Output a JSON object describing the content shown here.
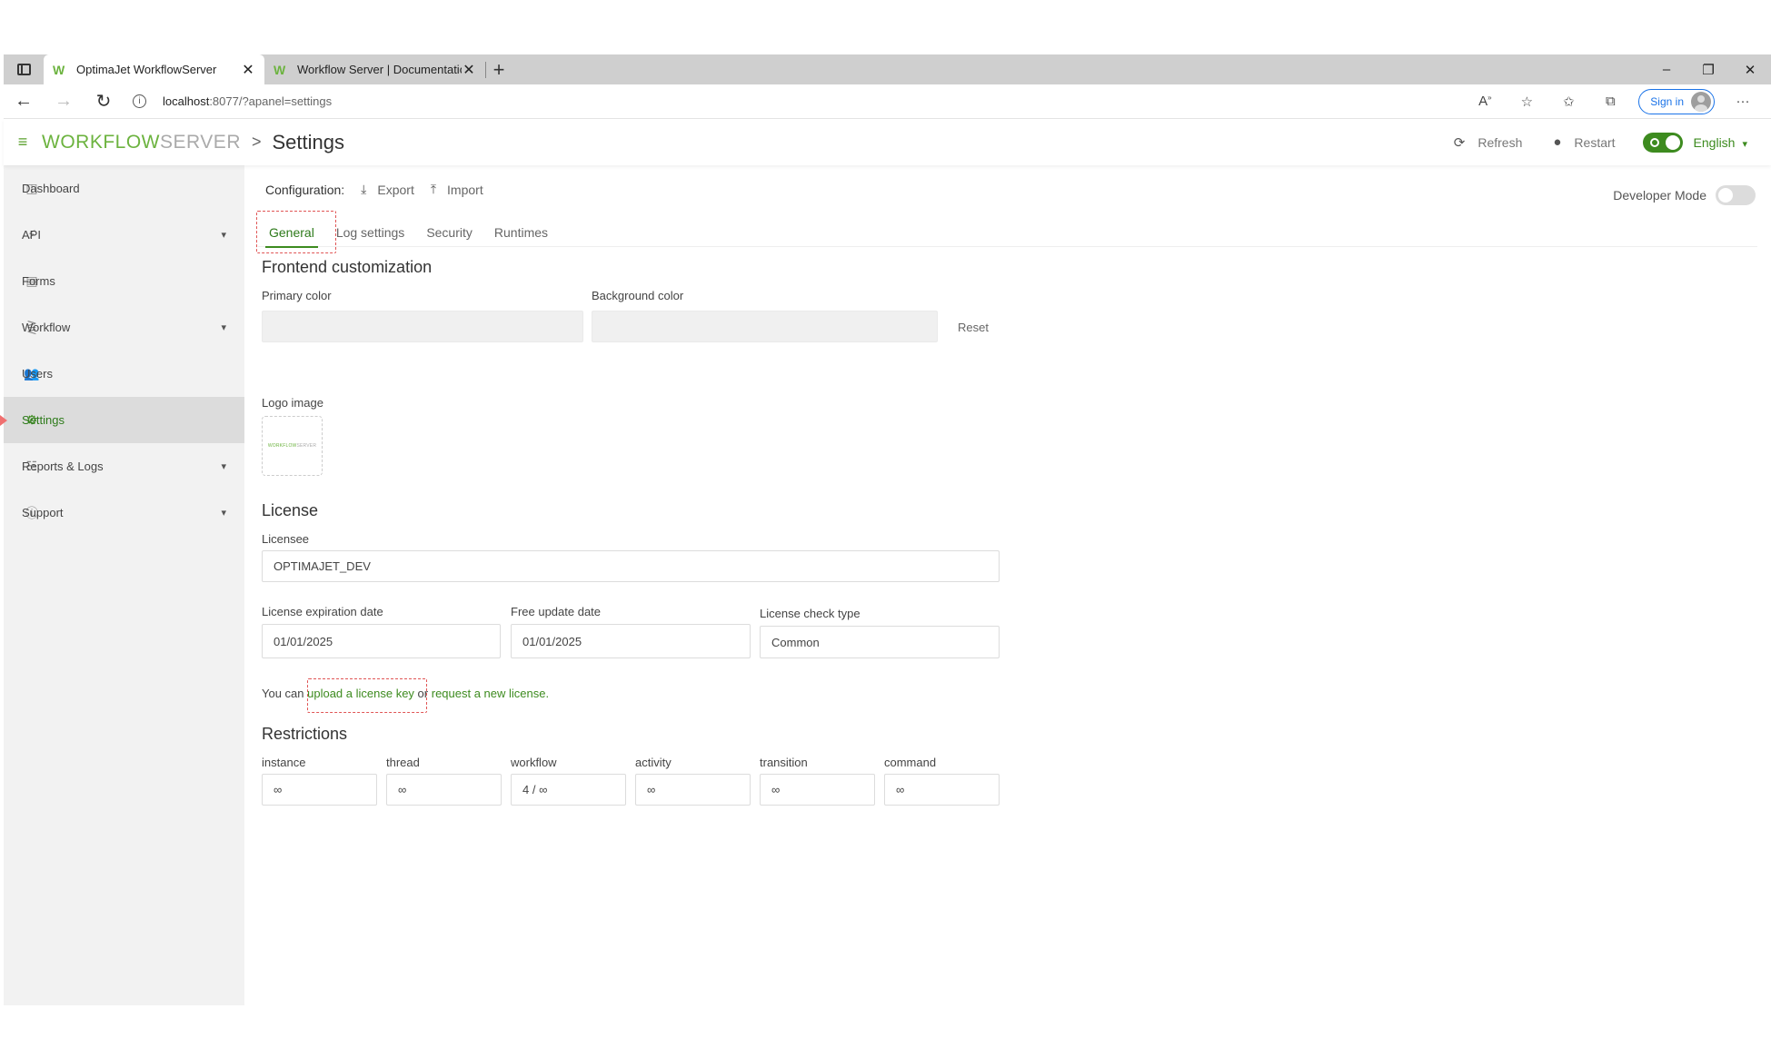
{
  "browser": {
    "tabs": [
      {
        "title": "OptimaJet WorkflowServer",
        "active": true
      },
      {
        "title": "Workflow Server | Documentatio",
        "active": false
      }
    ],
    "url_host": "localhost",
    "url_rest": ":8077/?apanel=settings",
    "signin_label": "Sign in",
    "window_controls": [
      "–",
      "❐",
      "✕"
    ]
  },
  "header": {
    "logo_primary": "WORKFLOW",
    "logo_secondary": "SERVER",
    "breadcrumb_sep": ">",
    "page_title": "Settings",
    "refresh_label": "Refresh",
    "restart_label": "Restart",
    "language": "English",
    "accent_color": "#3d8b1f"
  },
  "sidebar": {
    "items": [
      {
        "label": "Dashboard",
        "icon": "dashboard-icon",
        "has_children": false
      },
      {
        "label": "API",
        "icon": "plug-icon",
        "has_children": true
      },
      {
        "label": "Forms",
        "icon": "forms-icon",
        "has_children": false
      },
      {
        "label": "Workflow",
        "icon": "workflow-icon",
        "has_children": true
      },
      {
        "label": "Users",
        "icon": "users-icon",
        "has_children": false
      },
      {
        "label": "Settings",
        "icon": "gears-icon",
        "has_children": false,
        "active": true
      },
      {
        "label": "Reports & Logs",
        "icon": "reports-icon",
        "has_children": true
      },
      {
        "label": "Support",
        "icon": "help-icon",
        "has_children": true
      }
    ]
  },
  "main": {
    "config_label": "Configuration:",
    "export_label": "Export",
    "import_label": "Import",
    "developer_mode_label": "Developer Mode",
    "tabs": [
      {
        "label": "General",
        "active": true
      },
      {
        "label": "Log settings"
      },
      {
        "label": "Security"
      },
      {
        "label": "Runtimes"
      }
    ],
    "frontend": {
      "title": "Frontend customization",
      "primary_color_label": "Primary color",
      "primary_color_value": "",
      "background_color_label": "Background color",
      "background_color_value": "",
      "reset_label": "Reset",
      "logo_image_label": "Logo image"
    },
    "license": {
      "title": "License",
      "licensee_label": "Licensee",
      "licensee_value": "OPTIMAJET_DEV",
      "expiration_label": "License expiration date",
      "expiration_value": "01/01/2025",
      "free_update_label": "Free update date",
      "free_update_value": "01/01/2025",
      "check_type_label": "License check type",
      "check_type_value": "Common",
      "note_prefix": "You can ",
      "upload_link": "upload a license key",
      "note_middle": " or ",
      "request_link": "request a new license."
    },
    "restrictions": {
      "title": "Restrictions",
      "items": [
        {
          "label": "instance",
          "value": "∞"
        },
        {
          "label": "thread",
          "value": "∞"
        },
        {
          "label": "workflow",
          "value": "4 / ∞"
        },
        {
          "label": "activity",
          "value": "∞"
        },
        {
          "label": "transition",
          "value": "∞"
        },
        {
          "label": "command",
          "value": "∞"
        }
      ]
    }
  }
}
